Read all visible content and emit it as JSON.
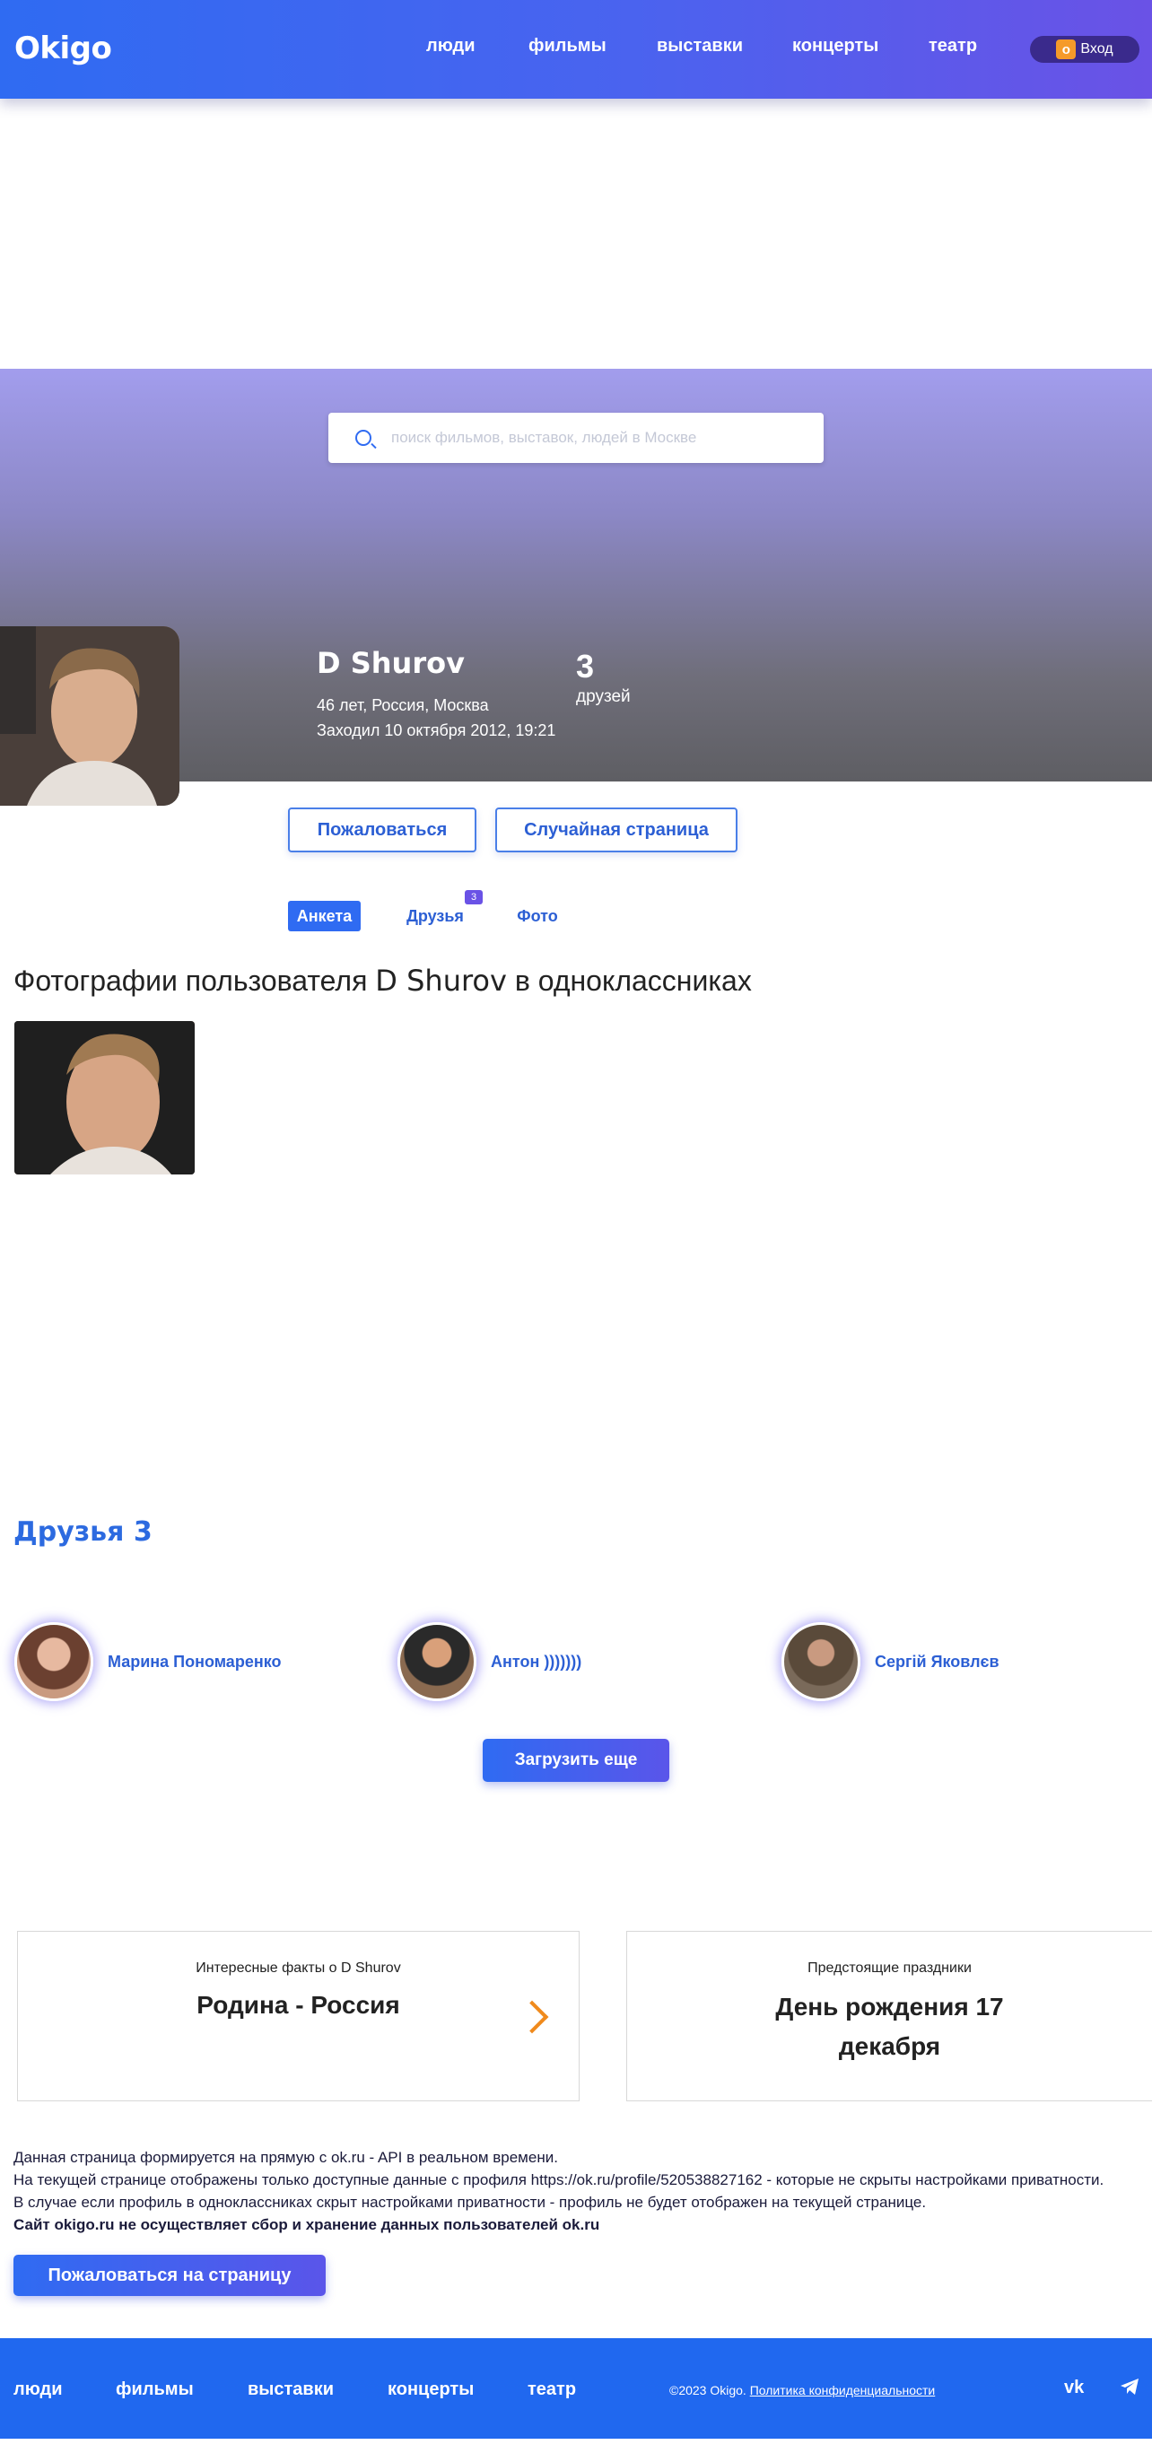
{
  "header": {
    "logo": "Okigo",
    "nav": [
      "люди",
      "фильмы",
      "выставки",
      "концерты",
      "театр"
    ],
    "login_label": "Вход",
    "login_icon": "ok-icon"
  },
  "search": {
    "placeholder": "поиск фильмов, выставок, людей в Москве"
  },
  "profile": {
    "name": "D Shurov",
    "details": "46 лет, Россия, Москва",
    "last_seen": "Заходил 10 октября 2012, 19:21",
    "friends_count": "3",
    "friends_label": "друзей"
  },
  "actions": {
    "report": "Пожаловаться",
    "random": "Случайная страница"
  },
  "tabs": [
    {
      "label": "Анкета"
    },
    {
      "label": "Друзья",
      "badge": "3"
    },
    {
      "label": "Фото"
    }
  ],
  "photos": {
    "title_prefix": "Фотографии пользователя",
    "title_name": "D Shurov",
    "title_suffix": "в одноклассниках"
  },
  "friends": {
    "title": "Друзья 3",
    "items": [
      {
        "name": "Марина Пономаренко"
      },
      {
        "name": "Антон )))))))"
      },
      {
        "name": "Сергій Яковлєв"
      }
    ],
    "load_more": "Загрузить еще"
  },
  "cards": {
    "facts_caption": "Интересные факты о D Shurov",
    "facts_value": "Родина - Россия",
    "holidays_caption": "Предстоящие праздники",
    "holidays_value": "День рождения 17 декабря"
  },
  "disclaimer": {
    "line1": "Данная страница формируется на прямую с ok.ru - API в реальном времени.",
    "line2": "На текущей странице отображены только доступные данные с профиля https://ok.ru/profile/520538827162 - которые не скрыты настройками приватности.",
    "line3": "В случае если профиль в одноклассниках скрыт настройками приватности - профиль не будет отображен на текущей странице.",
    "line4": "Сайт okigo.ru не осуществляет сбор и хранение данных пользователей ok.ru",
    "report_page": "Пожаловаться на страницу"
  },
  "footer": {
    "nav": [
      "люди",
      "фильмы",
      "выставки",
      "концерты",
      "театр"
    ],
    "copyright": "©2023 Okigo.",
    "privacy": "Политика конфиденциальности",
    "social": [
      "vk-icon",
      "telegram-icon"
    ]
  },
  "colors": {
    "brand": "#2f6bf2",
    "accent": "#6a52e6",
    "orange": "#f08a1c"
  }
}
